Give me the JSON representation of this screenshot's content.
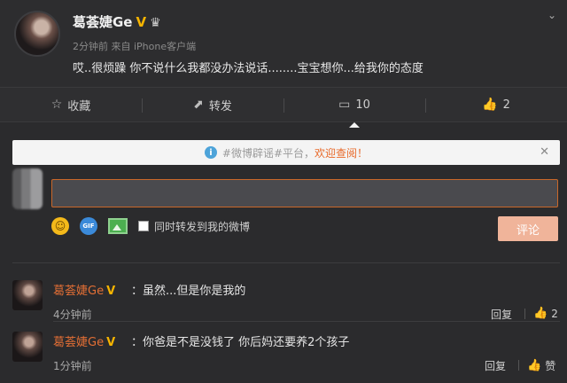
{
  "post": {
    "author": "葛荟婕Ge",
    "verified_badge": "V",
    "member_icon": "crown-icon",
    "meta": "2分钟前 来自 iPhone客户端",
    "content": "哎..很烦躁 你不说什么我都没办法说话........宝宝想你...给我你的态度"
  },
  "actions": [
    {
      "icon": "star-icon",
      "label": "收藏"
    },
    {
      "icon": "share-icon",
      "label": "转发"
    },
    {
      "icon": "comment-icon",
      "label": "10"
    },
    {
      "icon": "thumbs-up-icon",
      "label": "2"
    }
  ],
  "notice": {
    "text": "#微博辟谣#平台，",
    "link": "欢迎查阅！"
  },
  "compose": {
    "input_value": "",
    "repost_label": "同时转发到我的微博",
    "reply_label": "评论"
  },
  "comments": [
    {
      "author": "葛荟婕Ge",
      "badge": "V",
      "text": "：虽然...但是你是我的",
      "time": "4分钟前",
      "reply_label": "回复",
      "like_label": "2"
    },
    {
      "author": "葛荟婕Ge",
      "badge": "V",
      "text": "：你爸是不是没钱了 你后妈还要养2个孩子",
      "time": "1分钟前",
      "reply_label": "回复",
      "like_label": "赞"
    }
  ],
  "colors": {
    "background": "#2b2b2d",
    "accent": "#e36f35",
    "verified": "#f6b400",
    "reply_button": "#f0b49a"
  }
}
